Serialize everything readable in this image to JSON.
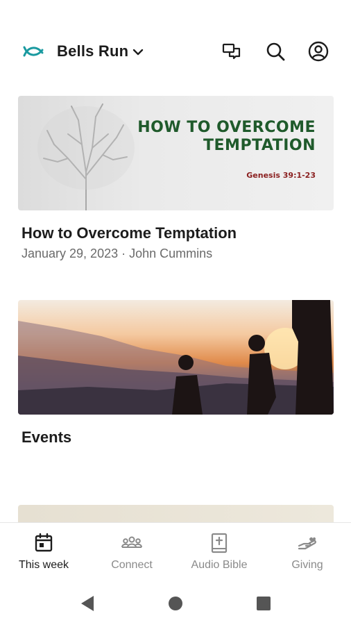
{
  "header": {
    "church_name": "Bells Run",
    "logo_icon": "fish-icon",
    "accent_color": "#1a9aa0",
    "icons": [
      "chat-icon",
      "search-icon",
      "account-icon"
    ]
  },
  "cards": [
    {
      "image_heading": "HOW TO OVERCOME\nTEMPTATION",
      "image_heading_line1": "HOW TO OVERCOME",
      "image_heading_line2": "TEMPTATION",
      "image_reference": "Genesis 39:1-23",
      "title": "How to Overcome Temptation",
      "subtitle": "January 29, 2023 · John Cummins"
    },
    {
      "title": "Events"
    }
  ],
  "bottom_nav": [
    {
      "label": "This week",
      "icon": "calendar-icon",
      "active": true
    },
    {
      "label": "Connect",
      "icon": "group-icon",
      "active": false
    },
    {
      "label": "Audio Bible",
      "icon": "bible-icon",
      "active": false
    },
    {
      "label": "Giving",
      "icon": "giving-hand-icon",
      "active": false
    }
  ],
  "system_nav": [
    "back-icon",
    "home-icon",
    "recents-icon"
  ]
}
